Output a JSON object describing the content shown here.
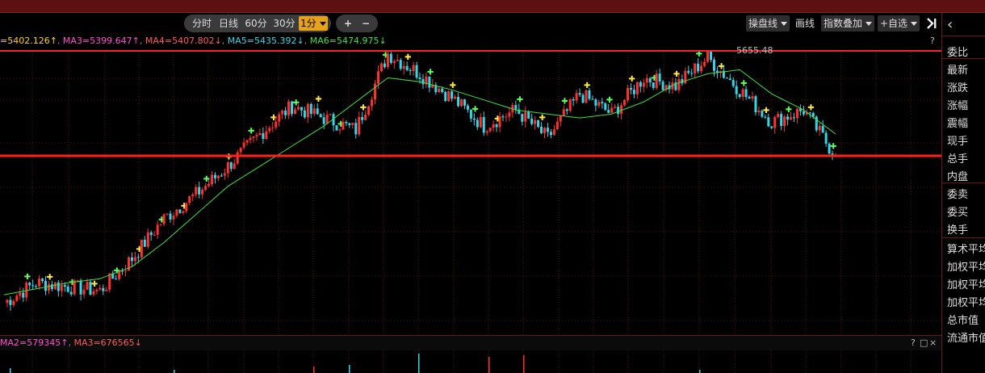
{
  "toolbar": {
    "period_buttons": [
      "分时",
      "日线",
      "60分",
      "30分",
      "1分"
    ],
    "plus": "+",
    "minus": "−",
    "tools": [
      "操盘线",
      "画线",
      "指数叠加",
      "自选"
    ],
    "add_watchlist_label": "+自选",
    "help": "?"
  },
  "legend": {
    "items": [
      {
        "text": "=5402.126↑",
        "color": "#ffd21f"
      },
      {
        "text": "MA3=5399.647↑",
        "color": "#ff4fcf"
      },
      {
        "text": "MA4=5407.802↓",
        "color": "#ff5b5b"
      },
      {
        "text": "MA5=5435.392↓",
        "color": "#35d6e8"
      },
      {
        "text": "MA6=5474.975↓",
        "color": "#40e040"
      }
    ]
  },
  "sub_legend": {
    "items": [
      {
        "text": "MA2=579345↑",
        "color": "#ff4fcf"
      },
      {
        "text": "MA3=676565↓",
        "color": "#ff5b5b"
      }
    ],
    "icons": [
      "?",
      "□",
      "×"
    ]
  },
  "right_panel": {
    "collapse": "‹",
    "rows": [
      "委比",
      "最新",
      "涨跌",
      "涨幅",
      "震幅",
      "现手",
      "总手",
      "内盘",
      "委卖",
      "委买",
      "换手",
      "算术平均",
      "加权平均",
      "加权平均",
      "加权平均",
      "总市值",
      "流通市值"
    ]
  },
  "chart_data": {
    "type": "candlestick",
    "peak_label": "5655.48",
    "colors": {
      "up": "#ff3030",
      "down": "#35d6e8",
      "ma": "#40e040",
      "hline": "#ff2020"
    },
    "series": [
      {
        "name": "MA6",
        "values": [
          5060,
          5075,
          5090,
          5100,
          5130,
          5190,
          5260,
          5330,
          5380,
          5430,
          5480,
          5540,
          5600,
          5590,
          5570,
          5545,
          5520,
          5510,
          5500,
          5510,
          5540,
          5585,
          5610,
          5620,
          5560,
          5520,
          5460
        ]
      }
    ],
    "close": [
      5040,
      5090,
      5080,
      5070,
      5150,
      5250,
      5310,
      5380,
      5460,
      5530,
      5500,
      5470,
      5660,
      5610,
      5550,
      5480,
      5520,
      5450,
      5560,
      5510,
      5600,
      5580,
      5650,
      5570,
      5490,
      5520,
      5405
    ]
  }
}
